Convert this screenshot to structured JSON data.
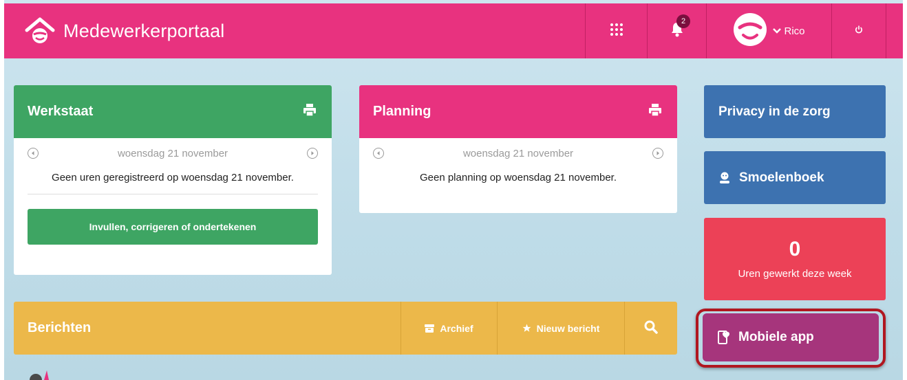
{
  "header": {
    "title": "Medewerkerportaal",
    "notification_count": "2",
    "user_name": "Rico",
    "brand_color": "#e8327f"
  },
  "werkstaat": {
    "title": "Werkstaat",
    "date": "woensdag 21 november",
    "message": "Geen uren geregistreerd op woensdag 21 november.",
    "button_label": "Invullen, corrigeren of ondertekenen",
    "color": "#3ea563"
  },
  "planning": {
    "title": "Planning",
    "date": "woensdag 21 november",
    "message": "Geen planning op woensdag 21 november.",
    "color": "#e8327f"
  },
  "berichten": {
    "title": "Berichten",
    "archief_label": "Archief",
    "nieuw_label": "Nieuw bericht",
    "color": "#ecb84a"
  },
  "sidebar": {
    "privacy_label": "Privacy in de zorg",
    "smoelenboek_label": "Smoelenboek",
    "uren_value": "0",
    "uren_label": "Uren gewerkt deze week",
    "mobiele_label": "Mobiele app",
    "privacy_color": "#3d72b0",
    "uren_color": "#ec4157",
    "mobiele_color": "#a6357c"
  },
  "icons": [
    "home-logo-icon",
    "apps-grid-icon",
    "bell-icon",
    "avatar-icon",
    "chevron-down-icon",
    "power-icon",
    "printer-icon",
    "arrow-left-circle-icon",
    "arrow-right-circle-icon",
    "archive-icon",
    "star-icon",
    "search-icon",
    "person-icon",
    "mobile-icon"
  ]
}
